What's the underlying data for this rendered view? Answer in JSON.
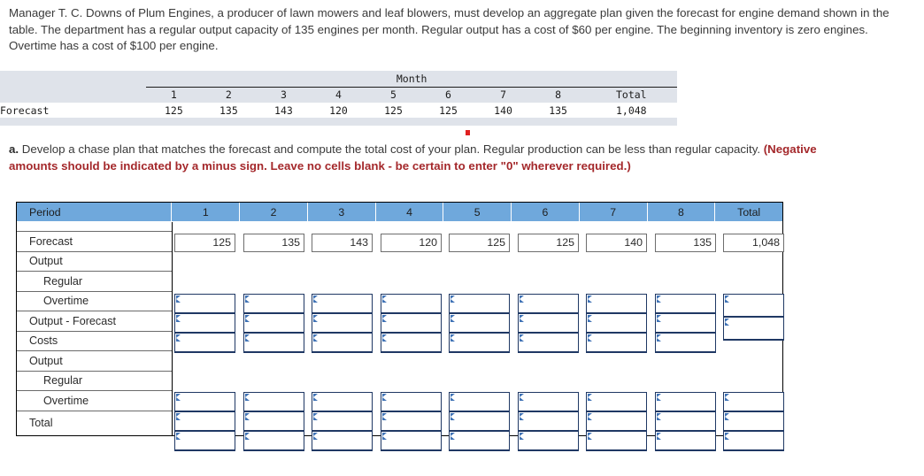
{
  "intro": {
    "text": "Manager T. C. Downs of Plum Engines, a producer of lawn mowers and leaf blowers, must develop an aggregate plan given the forecast for engine demand shown in the table. The department has a regular output capacity of 135 engines per month. Regular output has a cost of $60 per engine. The beginning inventory is zero engines. Overtime has a cost of $100 per engine."
  },
  "month_table": {
    "group_header": "Month",
    "columns": [
      "1",
      "2",
      "3",
      "4",
      "5",
      "6",
      "7",
      "8",
      "Total"
    ],
    "row_label": "Forecast",
    "values": [
      "125",
      "135",
      "143",
      "120",
      "125",
      "125",
      "140",
      "135",
      "1,048"
    ]
  },
  "question": {
    "marker": "a.",
    "body": " Develop a chase plan that matches the forecast and compute the total cost of your plan. Regular production can be less than regular capacity. ",
    "warning": "(Negative amounts should be indicated by a minus sign. Leave no cells blank - be certain to enter \"0\" wherever required.)"
  },
  "worksheet": {
    "header": {
      "period_label": "Period",
      "columns": [
        "1",
        "2",
        "3",
        "4",
        "5",
        "6",
        "7",
        "8"
      ],
      "total_label": "Total"
    },
    "rows": [
      {
        "label": "Forecast",
        "indent": false
      },
      {
        "label": "Output",
        "indent": false
      },
      {
        "label": "Regular",
        "indent": true
      },
      {
        "label": "Overtime",
        "indent": true
      },
      {
        "label": "Output - Forecast",
        "indent": false
      },
      {
        "label": "Costs",
        "indent": false
      },
      {
        "label": "Output",
        "indent": false
      },
      {
        "label": "Regular",
        "indent": true
      },
      {
        "label": "Overtime",
        "indent": true
      },
      {
        "label": "Total",
        "indent": false
      }
    ],
    "forecast_values": [
      "125",
      "135",
      "143",
      "120",
      "125",
      "125",
      "140",
      "135",
      "1,048"
    ],
    "input_values": {
      "output_regular": [
        "",
        "",
        "",
        "",
        "",
        "",
        "",
        "",
        ""
      ],
      "output_overtime": [
        "",
        "",
        "",
        "",
        "",
        "",
        "",
        "",
        ""
      ],
      "output_minus_forecast": [
        "",
        "",
        "",
        "",
        "",
        "",
        "",
        ""
      ],
      "costs_regular": [
        "",
        "",
        "",
        "",
        "",
        "",
        "",
        "",
        ""
      ],
      "costs_overtime": [
        "",
        "",
        "",
        "",
        "",
        "",
        "",
        "",
        ""
      ],
      "costs_total": [
        "",
        "",
        "",
        "",
        "",
        "",
        "",
        "",
        ""
      ]
    }
  },
  "colors": {
    "header_blue": "#6fa8dc",
    "band_gray": "#dfe3ea",
    "warning_red": "#a4282b",
    "input_border": "#1f3864",
    "marker_red": "#e02020"
  }
}
